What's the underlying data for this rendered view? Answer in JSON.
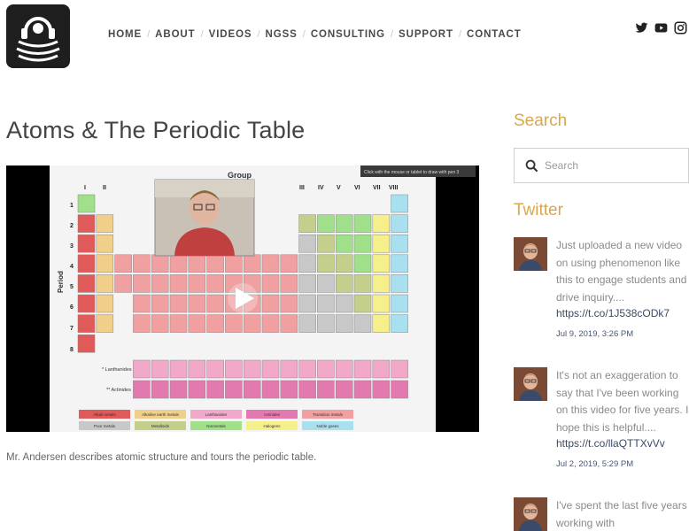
{
  "header": {
    "nav": [
      "HOME",
      "ABOUT",
      "VIDEOS",
      "NGSS",
      "CONSULTING",
      "SUPPORT",
      "CONTACT"
    ],
    "social_icons": [
      "twitter-icon",
      "youtube-icon",
      "instagram-icon"
    ]
  },
  "main": {
    "title": "Atoms & The Periodic Table",
    "video": {
      "overlay_text": "Click with the mouse or tablet to draw with pen 3",
      "group_label": "Group",
      "period_label": "Period",
      "group_numerals": [
        "I",
        "II",
        "III",
        "IV",
        "V",
        "VI",
        "VII",
        "VIII"
      ],
      "period_numbers": [
        "1",
        "2",
        "3",
        "4",
        "5",
        "6",
        "7",
        "8"
      ],
      "lanthanides": "* Lanthanides",
      "actinides": "** Actinides",
      "legend_row1": [
        "Alkali metals",
        "Alkaline earth metals",
        "Lanthanides",
        "Actinides",
        "Transition metals"
      ],
      "legend_row2": [
        "Poor metals",
        "Metalloids",
        "Nonmetals",
        "Halogens",
        "Noble gases"
      ]
    },
    "caption": "Mr. Andersen describes atomic structure and tours the periodic table."
  },
  "sidebar": {
    "search_heading": "Search",
    "search_placeholder": "Search",
    "twitter_heading": "Twitter",
    "tweets": [
      {
        "text": "Just uploaded a new video on using phenomenon like this to engage students and drive inquiry....",
        "link": "https://t.co/1J538cODk7",
        "date": "Jul 9, 2019, 3:26 PM"
      },
      {
        "text": "It's not an exaggeration to say that I've been working on this video for five years. I hope this is helpful....",
        "link": "https://t.co/llaQTTXvVv",
        "date": "Jul 2, 2019, 5:29 PM"
      },
      {
        "text": "I've spent the last five years working with"
      }
    ]
  },
  "colors": {
    "accent": "#d8a74e",
    "link": "#3b4a63",
    "alkali": "#e05a5a",
    "alkaline_earth": "#f0cf8a",
    "lanthanide": "#f2a8c8",
    "actinide": "#e27ab0",
    "transition": "#f0a0a0",
    "poor_metal": "#c8c8c8",
    "metalloid": "#c5cf8c",
    "nonmetal": "#a0e08a",
    "halogen": "#f6f08c",
    "noble": "#a8e0f0"
  }
}
